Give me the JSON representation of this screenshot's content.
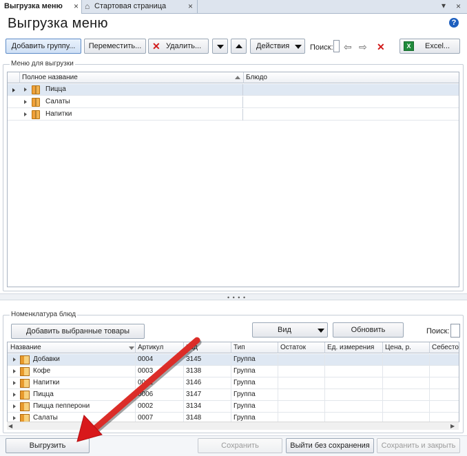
{
  "tabs": [
    {
      "label": "Выгрузка меню",
      "active": true
    },
    {
      "label": "Стартовая страница",
      "active": false
    }
  ],
  "tab_icons": {
    "close": "×",
    "home": "⌂",
    "menu": "▾"
  },
  "page": {
    "title": "Выгрузка меню",
    "help": "?"
  },
  "toolbar": {
    "add_group": "Добавить группу...",
    "move": "Переместить...",
    "delete": "Удалить...",
    "actions": "Действия",
    "search_label": "Поиск:",
    "search_value": "",
    "excel": "Excel..."
  },
  "menu_section": {
    "title": "Меню для выгрузки",
    "columns": [
      "Полное название",
      "Блюдо"
    ],
    "rows": [
      {
        "name": "Пицца",
        "dish": "",
        "selected": true
      },
      {
        "name": "Салаты",
        "dish": "",
        "selected": false
      },
      {
        "name": "Напитки",
        "dish": "",
        "selected": false
      }
    ]
  },
  "splitter": {
    "grip": "• • • •"
  },
  "nomen_section": {
    "title": "Номенклатура блюд",
    "add_selected": "Добавить выбранные товары",
    "view": "Вид",
    "refresh": "Обновить",
    "search_label": "Поиск:",
    "search_value": "",
    "columns": [
      "Название",
      "Артикул",
      "Код",
      "Тип",
      "Остаток",
      "Ед. измерения",
      "Цена, р.",
      "Себестоим"
    ],
    "rows": [
      {
        "name": "Добавки",
        "article": "0004",
        "code": "3145",
        "type": "Группа"
      },
      {
        "name": "Кофе",
        "article": "0003",
        "code": "3138",
        "type": "Группа"
      },
      {
        "name": "Напитки",
        "article": "0001",
        "code": "3146",
        "type": "Группа"
      },
      {
        "name": "Пицца",
        "article": "0006",
        "code": "3147",
        "type": "Группа"
      },
      {
        "name": "Пицца пепперони",
        "article": "0002",
        "code": "3134",
        "type": "Группа"
      },
      {
        "name": "Салаты",
        "article": "0007",
        "code": "3148",
        "type": "Группа"
      }
    ]
  },
  "footer": {
    "export": "Выгрузить",
    "save": "Сохранить",
    "exit_no_save": "Выйти без сохранения",
    "save_close": "Сохранить и закрыть"
  },
  "colors": {
    "accent": "#1d5fbf",
    "arrow": "#e0161a",
    "delete": "#d11a1a"
  }
}
